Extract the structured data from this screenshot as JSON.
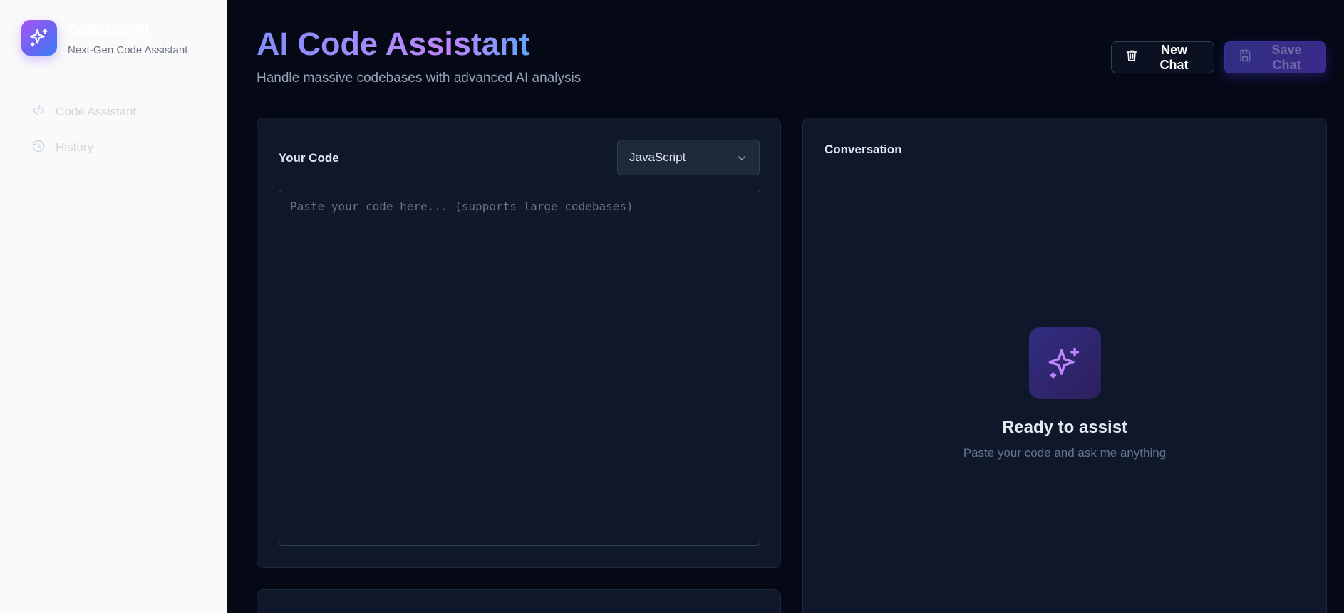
{
  "sidebar": {
    "brand_name": "CodeBot AI",
    "brand_subtitle": "Next-Gen Code Assistant",
    "items": [
      {
        "label": "Code Assistant",
        "icon": "code-icon"
      },
      {
        "label": "History",
        "icon": "history-icon"
      }
    ]
  },
  "header": {
    "title": "AI Code Assistant",
    "subtitle": "Handle massive codebases with advanced AI analysis",
    "new_chat_label": "New Chat",
    "save_chat_label": "Save Chat"
  },
  "code_panel": {
    "label": "Your Code",
    "language_selected": "JavaScript",
    "placeholder": "Paste your code here... (supports large codebases)"
  },
  "conversation": {
    "label": "Conversation",
    "empty_title": "Ready to assist",
    "empty_subtitle": "Paste your code and ask me anything"
  },
  "colors": {
    "background": "#050815",
    "sidebar": "#fafafa",
    "panel": "#0f172a",
    "accent_purple": "#a855f7",
    "accent_indigo": "#6366f1",
    "accent_blue": "#60a5fa"
  },
  "icons": [
    "sparkles-icon",
    "code-icon",
    "history-icon",
    "trash-icon",
    "save-icon",
    "chevron-down-icon"
  ]
}
